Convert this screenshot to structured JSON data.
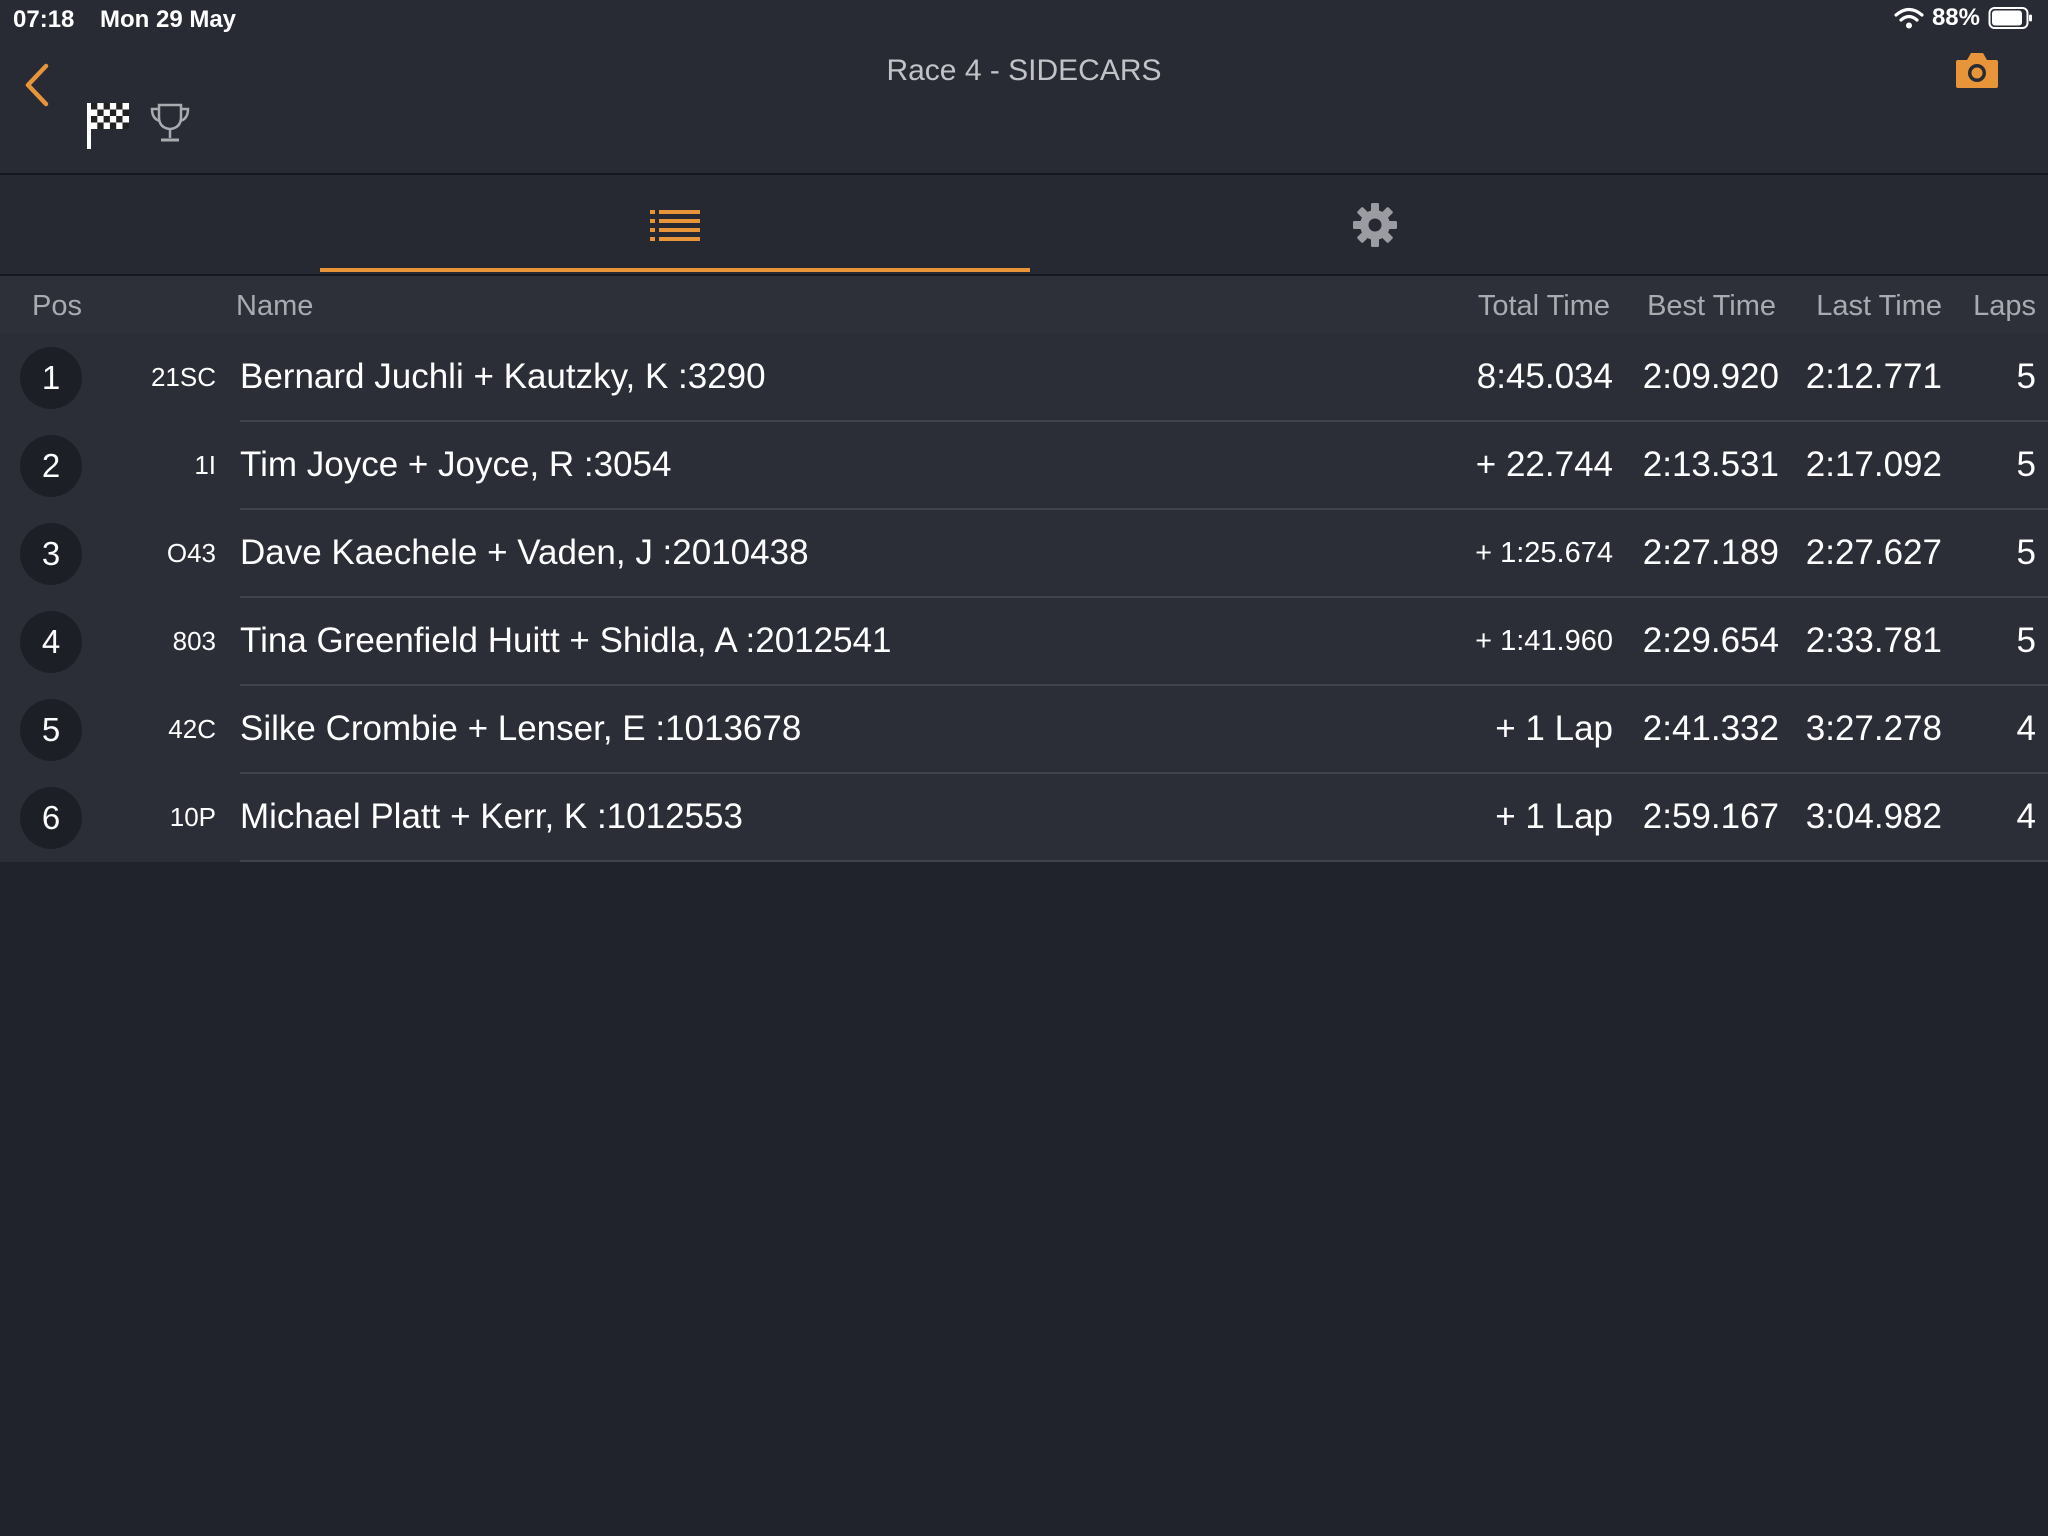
{
  "status_bar": {
    "time": "07:18",
    "date": "Mon 29 May",
    "battery": "88%"
  },
  "header": {
    "title": "Race 4 - SIDECARS"
  },
  "colors": {
    "accent": "#e8953a",
    "background": "#20232c"
  },
  "icons": {
    "back": "chevron-left-icon",
    "flag": "checkered-flag-icon",
    "trophy": "trophy-icon",
    "camera": "camera-icon",
    "list": "list-icon",
    "settings": "gear-icon"
  },
  "tabs": {
    "selected": "list"
  },
  "table": {
    "headers": {
      "pos": "Pos",
      "name": "Name",
      "total_time": "Total Time",
      "best_time": "Best Time",
      "last_time": "Last Time",
      "laps": "Laps"
    },
    "rows": [
      {
        "pos": "1",
        "number": "21SC",
        "name": "Bernard Juchli + Kautzky, K :3290",
        "total_time": "8:45.034",
        "best_time": "2:09.920",
        "last_time": "2:12.771",
        "laps": "5"
      },
      {
        "pos": "2",
        "number": "1I",
        "name": "Tim Joyce + Joyce, R :3054",
        "total_time": "+ 22.744",
        "best_time": "2:13.531",
        "last_time": "2:17.092",
        "laps": "5"
      },
      {
        "pos": "3",
        "number": "O43",
        "name": "Dave Kaechele + Vaden, J :2010438",
        "total_time": "+ 1:25.674",
        "best_time": "2:27.189",
        "last_time": "2:27.627",
        "laps": "5"
      },
      {
        "pos": "4",
        "number": "803",
        "name": "Tina Greenfield Huitt + Shidla, A :2012541",
        "total_time": "+ 1:41.960",
        "best_time": "2:29.654",
        "last_time": "2:33.781",
        "laps": "5"
      },
      {
        "pos": "5",
        "number": "42C",
        "name": "Silke Crombie + Lenser, E :1013678",
        "total_time": "+ 1 Lap",
        "best_time": "2:41.332",
        "last_time": "3:27.278",
        "laps": "4"
      },
      {
        "pos": "6",
        "number": "10P",
        "name": "Michael Platt + Kerr, K :1012553",
        "total_time": "+ 1 Lap",
        "best_time": "2:59.167",
        "last_time": "3:04.982",
        "laps": "4"
      }
    ]
  }
}
